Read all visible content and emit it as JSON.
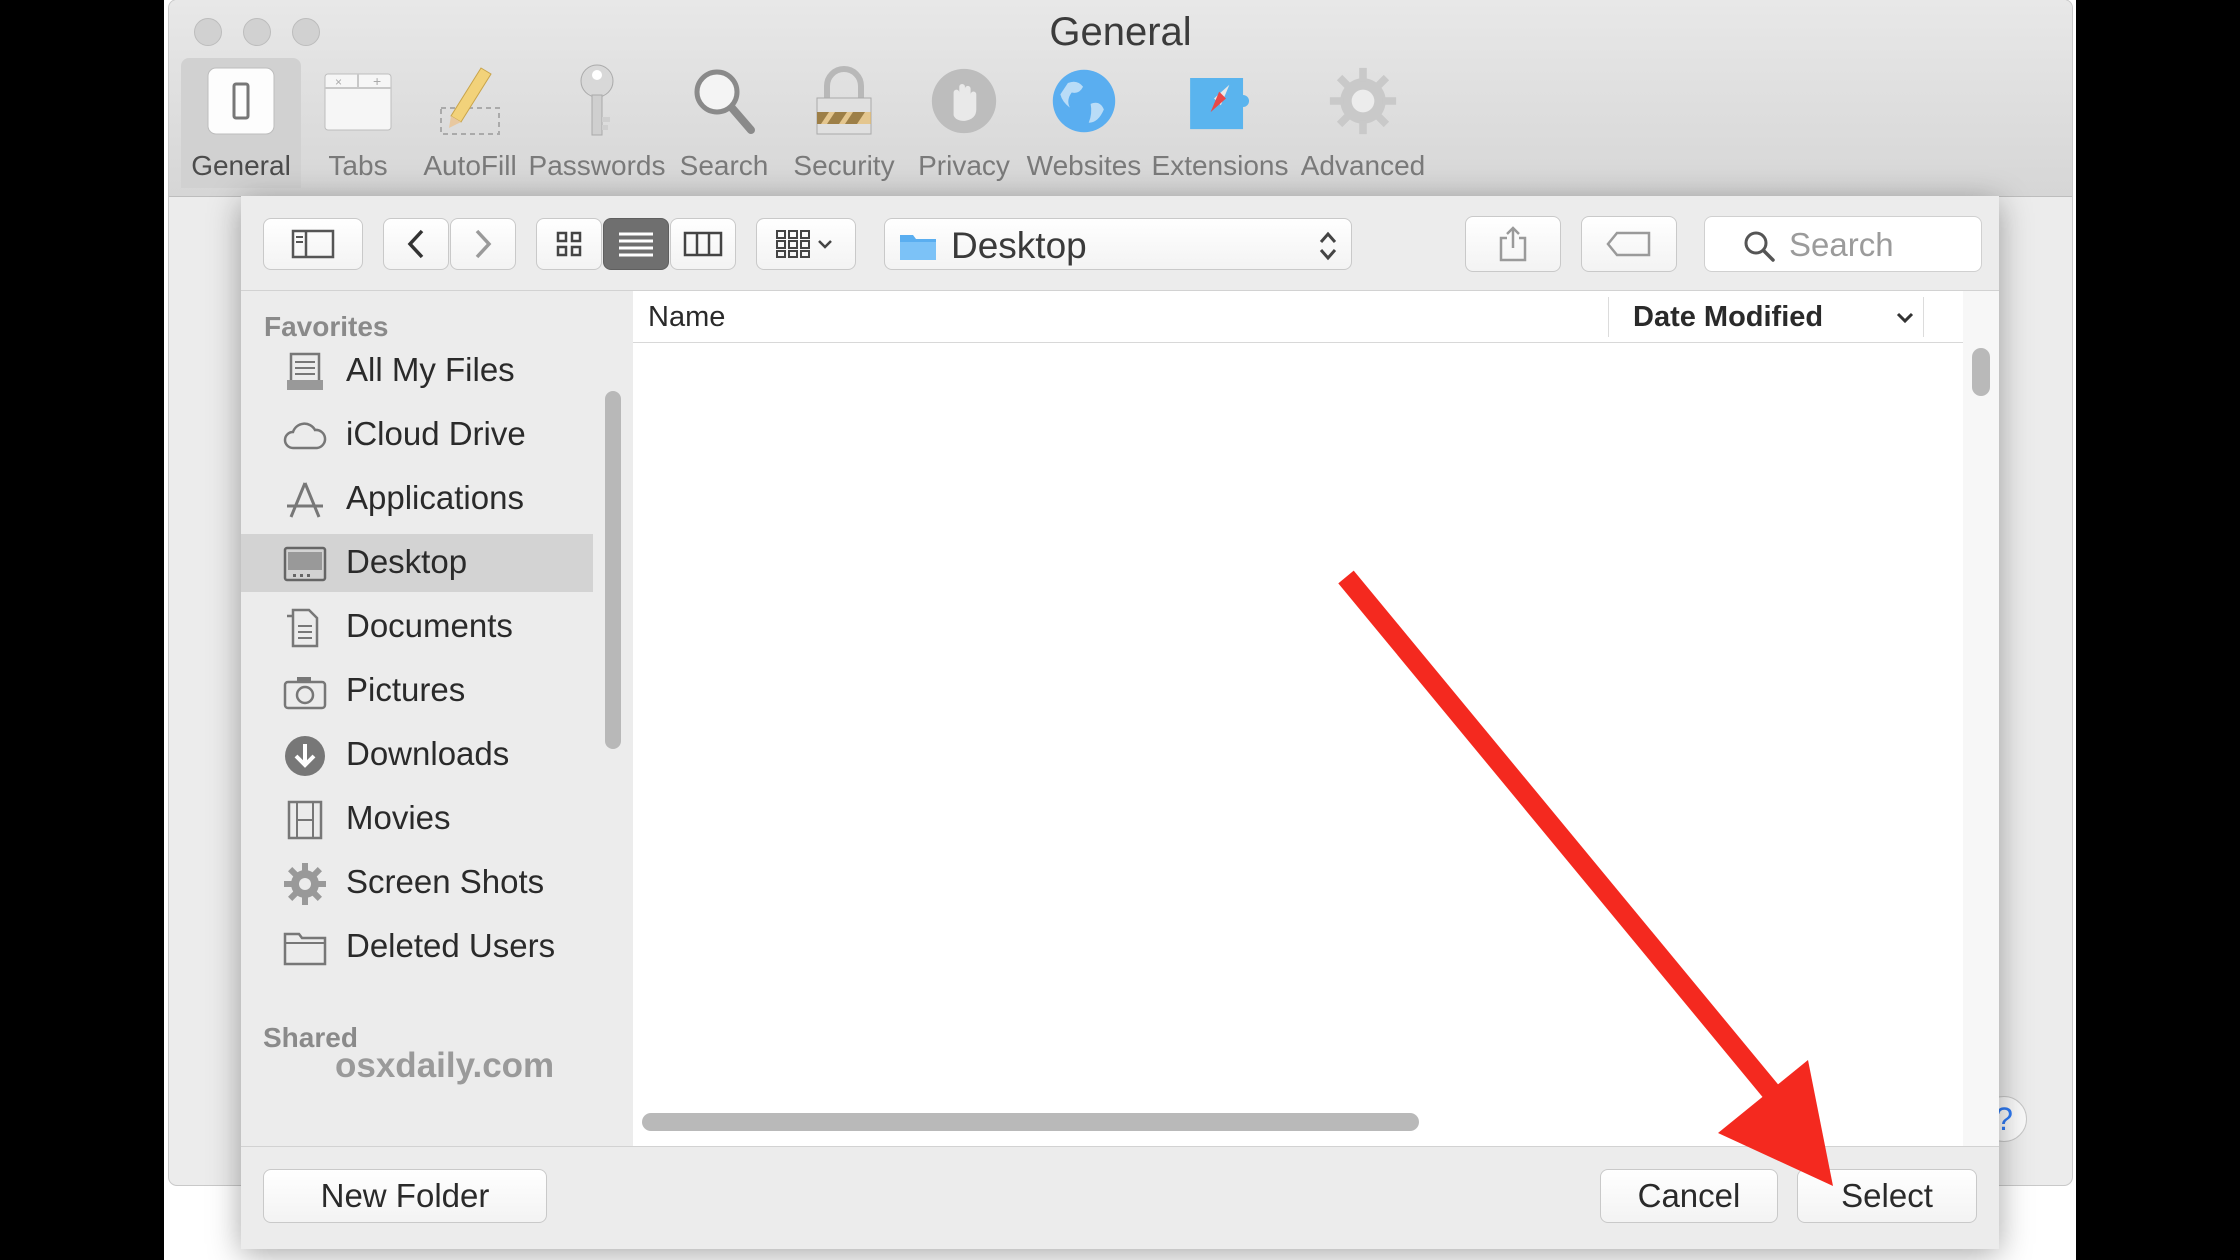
{
  "window": {
    "title": "General",
    "toolbar": [
      {
        "id": "general",
        "label": "General"
      },
      {
        "id": "tabs",
        "label": "Tabs"
      },
      {
        "id": "autofill",
        "label": "AutoFill"
      },
      {
        "id": "passwords",
        "label": "Passwords"
      },
      {
        "id": "search",
        "label": "Search"
      },
      {
        "id": "security",
        "label": "Security"
      },
      {
        "id": "privacy",
        "label": "Privacy"
      },
      {
        "id": "websites",
        "label": "Websites"
      },
      {
        "id": "extensions",
        "label": "Extensions"
      },
      {
        "id": "advanced",
        "label": "Advanced"
      }
    ],
    "selected_tab": "General",
    "help_label": "?"
  },
  "panel": {
    "location": "Desktop",
    "search_placeholder": "Search",
    "view_mode": "list",
    "sidebar": {
      "favorites_header": "Favorites",
      "favorites": [
        {
          "label": "All My Files",
          "icon": "all-my-files-icon"
        },
        {
          "label": "iCloud Drive",
          "icon": "cloud-icon"
        },
        {
          "label": "Applications",
          "icon": "applications-icon"
        },
        {
          "label": "Desktop",
          "icon": "desktop-icon",
          "selected": true
        },
        {
          "label": "Documents",
          "icon": "documents-icon"
        },
        {
          "label": "Pictures",
          "icon": "camera-icon"
        },
        {
          "label": "Downloads",
          "icon": "download-icon"
        },
        {
          "label": "Movies",
          "icon": "film-icon"
        },
        {
          "label": "Screen Shots",
          "icon": "gear-icon"
        },
        {
          "label": "Deleted Users",
          "icon": "folder-icon"
        }
      ],
      "shared_header": "Shared"
    },
    "columns": {
      "name": "Name",
      "date_modified": "Date Modified"
    },
    "buttons": {
      "new_folder": "New Folder",
      "cancel": "Cancel",
      "select": "Select"
    }
  },
  "watermark": "osxdaily.com",
  "colors": {
    "arrow": "#f4291f",
    "folder_blue": "#5aaef0"
  }
}
